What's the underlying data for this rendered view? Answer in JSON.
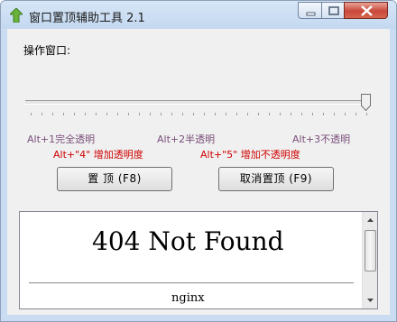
{
  "window": {
    "title": "窗口置顶辅助工具 2.1"
  },
  "main": {
    "operate_label": "操作窗口:",
    "slider": {
      "value_fraction": 1.0
    },
    "hints_row1": [
      "Alt+1完全透明",
      "Alt+2半透明",
      "Alt+3不透明"
    ],
    "hints_row2": [
      "Alt+\"4\" 增加透明度",
      "Alt+\"5\" 增加不透明度"
    ],
    "buttons": {
      "pin_label": "置  顶 (F8)",
      "unpin_label": "取消置顶 (F9)"
    }
  },
  "preview": {
    "heading": "404 Not Found",
    "footer": "nginx"
  },
  "colors": {
    "hint_purple": "#7a4e7a",
    "hint_red": "#d00000",
    "close_red": "#c9483a"
  }
}
